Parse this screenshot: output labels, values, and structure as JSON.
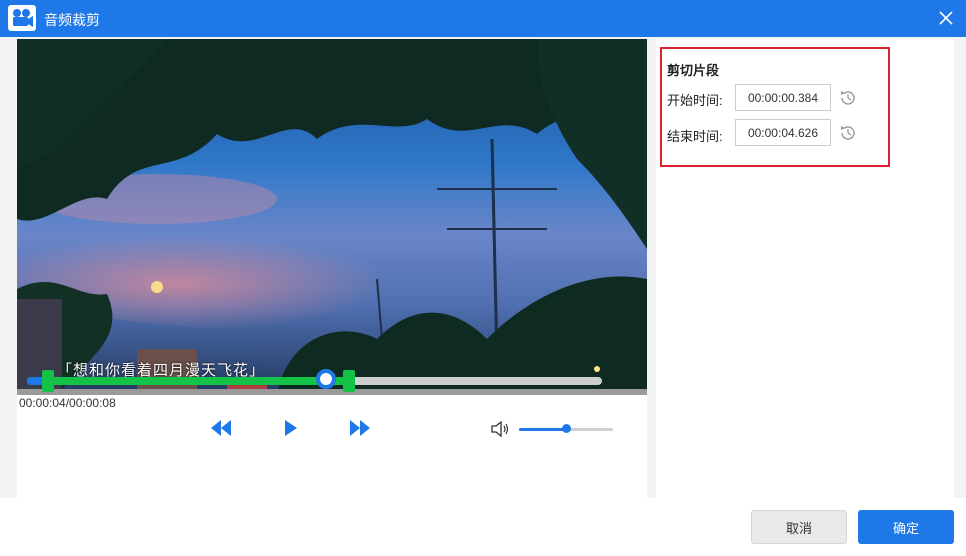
{
  "window": {
    "title": "音频裁剪",
    "close_icon": "close-icon",
    "app_icon": "video-camera-icon"
  },
  "player": {
    "subtitle": "「想和你看着四月漫天飞花」",
    "time_display": "00:00:04/00:00:08",
    "progress_fraction": 0.52,
    "clip_start_fraction": 0.036,
    "clip_end_fraction": 0.56,
    "controls": {
      "rewind_icon": "rewind-icon",
      "play_icon": "play-icon",
      "forward_icon": "fast-forward-icon"
    },
    "volume": {
      "icon": "speaker-icon",
      "level_fraction": 0.5
    }
  },
  "clip": {
    "heading": "剪切片段",
    "start_label": "开始时间:",
    "start_value": "00:00:00.384",
    "end_label": "结束时间:",
    "end_value": "00:00:04.626",
    "reset_icon": "clock-reset-icon"
  },
  "footer": {
    "cancel_label": "取消",
    "ok_label": "确定"
  },
  "colors": {
    "accent": "#1f78e8",
    "progress": "#14c247",
    "highlight_border": "#d9232e"
  }
}
